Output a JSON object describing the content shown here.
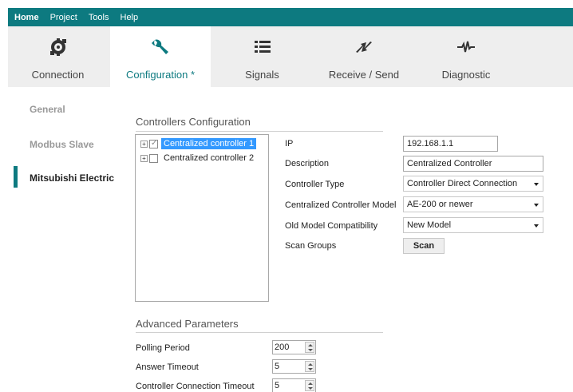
{
  "menu": [
    {
      "label": "Home"
    },
    {
      "label": "Project"
    },
    {
      "label": "Tools"
    },
    {
      "label": "Help"
    }
  ],
  "tabs": [
    {
      "label": "Connection",
      "icon": "gear-connection-icon"
    },
    {
      "label": "Configuration *",
      "icon": "wrench-icon"
    },
    {
      "label": "Signals",
      "icon": "list-icon"
    },
    {
      "label": "Receive / Send",
      "icon": "arrows-icon"
    },
    {
      "label": "Diagnostic",
      "icon": "pulse-icon"
    }
  ],
  "nav": [
    {
      "label": "General"
    },
    {
      "label": "Modbus Slave"
    },
    {
      "label": "Mitsubishi Electric"
    }
  ],
  "controllers": {
    "title": "Controllers Configuration",
    "tree": [
      {
        "label": "Centralized controller 1"
      },
      {
        "label": "Centralized controller 2"
      }
    ]
  },
  "form": {
    "ip_label": "IP",
    "ip_value": "192.168.1.1",
    "description_label": "Description",
    "description_value": "Centralized Controller",
    "controller_type_label": "Controller Type",
    "controller_type_value": "Controller Direct Connection",
    "model_label": "Centralized Controller Model",
    "model_value": "AE-200 or newer",
    "old_model_label": "Old Model Compatibility",
    "old_model_value": "New Model",
    "scan_groups_label": "Scan Groups",
    "scan_button": "Scan"
  },
  "advanced": {
    "title": "Advanced Parameters",
    "polling_label": "Polling Period",
    "polling_value": "200",
    "answer_label": "Answer Timeout",
    "answer_value": "5",
    "conn_label": "Controller Connection Timeout",
    "conn_value": "5"
  },
  "colors": {
    "accent": "#0d7a80",
    "selection": "#3399ff"
  }
}
